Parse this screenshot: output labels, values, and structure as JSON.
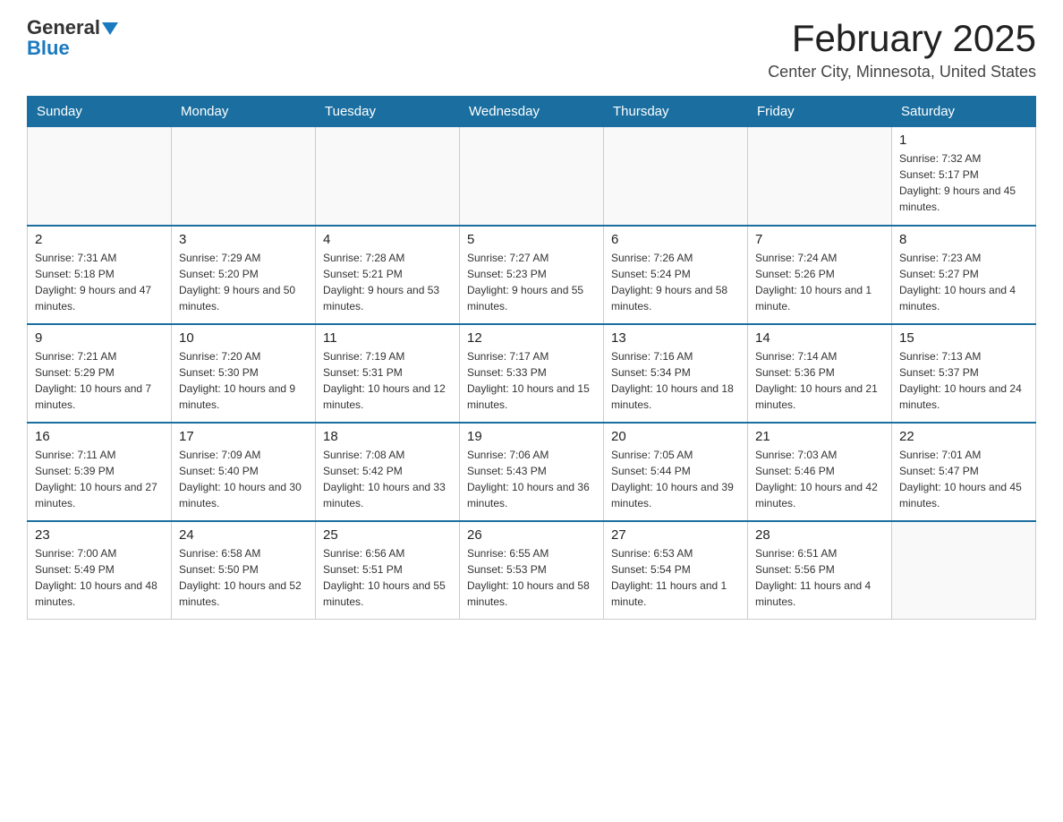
{
  "header": {
    "logo_general": "General",
    "logo_blue": "Blue",
    "title": "February 2025",
    "subtitle": "Center City, Minnesota, United States"
  },
  "days_of_week": [
    "Sunday",
    "Monday",
    "Tuesday",
    "Wednesday",
    "Thursday",
    "Friday",
    "Saturday"
  ],
  "weeks": [
    [
      {
        "num": "",
        "info": ""
      },
      {
        "num": "",
        "info": ""
      },
      {
        "num": "",
        "info": ""
      },
      {
        "num": "",
        "info": ""
      },
      {
        "num": "",
        "info": ""
      },
      {
        "num": "",
        "info": ""
      },
      {
        "num": "1",
        "info": "Sunrise: 7:32 AM\nSunset: 5:17 PM\nDaylight: 9 hours and 45 minutes."
      }
    ],
    [
      {
        "num": "2",
        "info": "Sunrise: 7:31 AM\nSunset: 5:18 PM\nDaylight: 9 hours and 47 minutes."
      },
      {
        "num": "3",
        "info": "Sunrise: 7:29 AM\nSunset: 5:20 PM\nDaylight: 9 hours and 50 minutes."
      },
      {
        "num": "4",
        "info": "Sunrise: 7:28 AM\nSunset: 5:21 PM\nDaylight: 9 hours and 53 minutes."
      },
      {
        "num": "5",
        "info": "Sunrise: 7:27 AM\nSunset: 5:23 PM\nDaylight: 9 hours and 55 minutes."
      },
      {
        "num": "6",
        "info": "Sunrise: 7:26 AM\nSunset: 5:24 PM\nDaylight: 9 hours and 58 minutes."
      },
      {
        "num": "7",
        "info": "Sunrise: 7:24 AM\nSunset: 5:26 PM\nDaylight: 10 hours and 1 minute."
      },
      {
        "num": "8",
        "info": "Sunrise: 7:23 AM\nSunset: 5:27 PM\nDaylight: 10 hours and 4 minutes."
      }
    ],
    [
      {
        "num": "9",
        "info": "Sunrise: 7:21 AM\nSunset: 5:29 PM\nDaylight: 10 hours and 7 minutes."
      },
      {
        "num": "10",
        "info": "Sunrise: 7:20 AM\nSunset: 5:30 PM\nDaylight: 10 hours and 9 minutes."
      },
      {
        "num": "11",
        "info": "Sunrise: 7:19 AM\nSunset: 5:31 PM\nDaylight: 10 hours and 12 minutes."
      },
      {
        "num": "12",
        "info": "Sunrise: 7:17 AM\nSunset: 5:33 PM\nDaylight: 10 hours and 15 minutes."
      },
      {
        "num": "13",
        "info": "Sunrise: 7:16 AM\nSunset: 5:34 PM\nDaylight: 10 hours and 18 minutes."
      },
      {
        "num": "14",
        "info": "Sunrise: 7:14 AM\nSunset: 5:36 PM\nDaylight: 10 hours and 21 minutes."
      },
      {
        "num": "15",
        "info": "Sunrise: 7:13 AM\nSunset: 5:37 PM\nDaylight: 10 hours and 24 minutes."
      }
    ],
    [
      {
        "num": "16",
        "info": "Sunrise: 7:11 AM\nSunset: 5:39 PM\nDaylight: 10 hours and 27 minutes."
      },
      {
        "num": "17",
        "info": "Sunrise: 7:09 AM\nSunset: 5:40 PM\nDaylight: 10 hours and 30 minutes."
      },
      {
        "num": "18",
        "info": "Sunrise: 7:08 AM\nSunset: 5:42 PM\nDaylight: 10 hours and 33 minutes."
      },
      {
        "num": "19",
        "info": "Sunrise: 7:06 AM\nSunset: 5:43 PM\nDaylight: 10 hours and 36 minutes."
      },
      {
        "num": "20",
        "info": "Sunrise: 7:05 AM\nSunset: 5:44 PM\nDaylight: 10 hours and 39 minutes."
      },
      {
        "num": "21",
        "info": "Sunrise: 7:03 AM\nSunset: 5:46 PM\nDaylight: 10 hours and 42 minutes."
      },
      {
        "num": "22",
        "info": "Sunrise: 7:01 AM\nSunset: 5:47 PM\nDaylight: 10 hours and 45 minutes."
      }
    ],
    [
      {
        "num": "23",
        "info": "Sunrise: 7:00 AM\nSunset: 5:49 PM\nDaylight: 10 hours and 48 minutes."
      },
      {
        "num": "24",
        "info": "Sunrise: 6:58 AM\nSunset: 5:50 PM\nDaylight: 10 hours and 52 minutes."
      },
      {
        "num": "25",
        "info": "Sunrise: 6:56 AM\nSunset: 5:51 PM\nDaylight: 10 hours and 55 minutes."
      },
      {
        "num": "26",
        "info": "Sunrise: 6:55 AM\nSunset: 5:53 PM\nDaylight: 10 hours and 58 minutes."
      },
      {
        "num": "27",
        "info": "Sunrise: 6:53 AM\nSunset: 5:54 PM\nDaylight: 11 hours and 1 minute."
      },
      {
        "num": "28",
        "info": "Sunrise: 6:51 AM\nSunset: 5:56 PM\nDaylight: 11 hours and 4 minutes."
      },
      {
        "num": "",
        "info": ""
      }
    ]
  ]
}
